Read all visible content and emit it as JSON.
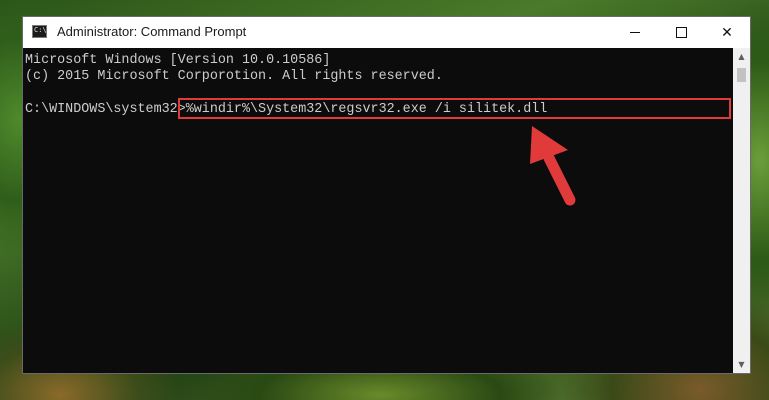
{
  "window": {
    "title": "Administrator: Command Prompt",
    "icon": "cmd-icon",
    "icon_glyph": "C:\\",
    "controls": {
      "minimize": "minimize-icon",
      "maximize": "maximize-icon",
      "close_glyph": "✕"
    }
  },
  "console": {
    "line1": "Microsoft Windows [Version 10.0.10586]",
    "line2": "(c) 2015 Microsoft Corporotion. All rights reserved.",
    "prompt": "C:\\WINDOWS\\system32>",
    "command": "%windir%\\System32\\regsvr32.exe /i silitek.dll"
  },
  "annotation": {
    "highlight_color": "#e03a3a",
    "arrow_color": "#e03a3a"
  },
  "scrollbar": {
    "up_glyph": "▲",
    "down_glyph": "▼"
  }
}
